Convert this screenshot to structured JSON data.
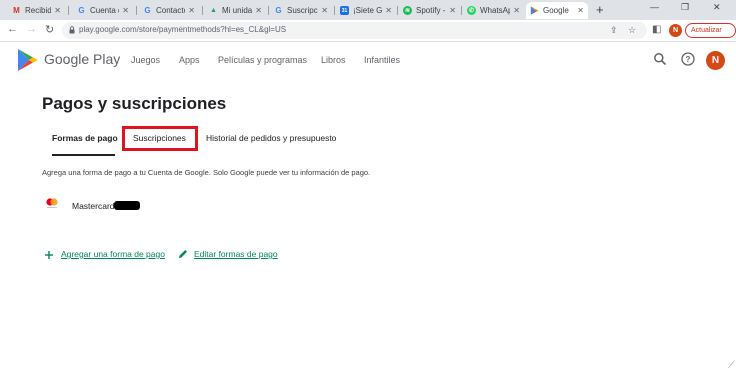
{
  "browser": {
    "tabs": [
      {
        "label": "Recibido",
        "favicon": "gmail-icon",
        "color": "#d93025",
        "glyph": "M"
      },
      {
        "label": "Cuenta de",
        "favicon": "google-icon",
        "color": "#4285f4",
        "glyph": "G"
      },
      {
        "label": "Contacto",
        "favicon": "google-icon",
        "color": "#4285f4",
        "glyph": "G"
      },
      {
        "label": "Mi unidad",
        "favicon": "drive-icon",
        "color": "#1fa463",
        "glyph": "▲"
      },
      {
        "label": "Suscripc",
        "favicon": "google-icon",
        "color": "#4285f4",
        "glyph": "G"
      },
      {
        "label": "¡Siete Gr",
        "favicon": "calendar-icon",
        "color": "#1a73e8",
        "glyph": "31"
      },
      {
        "label": "Spotify -",
        "favicon": "spotify-icon",
        "color": "#1db954",
        "glyph": "≋"
      },
      {
        "label": "WhatsApp",
        "favicon": "whatsapp-icon",
        "color": "#25d366",
        "glyph": "✆"
      },
      {
        "label": "Google",
        "favicon": "play-icon",
        "color": "#ffffff",
        "glyph": "▶"
      }
    ],
    "new_tab": "+",
    "url": "play.google.com/store/paymentmethods?hl=es_CL&gl=US",
    "update_button": "Actualizar",
    "profile_initial": "N"
  },
  "header": {
    "logo_text": "Google Play",
    "nav": [
      "Juegos",
      "Apps",
      "Películas y programas",
      "Libros",
      "Infantiles"
    ],
    "profile_initial": "N"
  },
  "main": {
    "title": "Pagos y suscripciones",
    "tabs": [
      "Formas de pago",
      "Suscripciones",
      "Historial de pedidos y presupuesto"
    ],
    "active_tab": "Formas de pago",
    "info_text": "Agrega una forma de pago a tu Cuenta de Google. Solo Google puede ver tu información de pago.",
    "payment_method": "Mastercard",
    "actions": {
      "add": "Agregar una forma de pago",
      "edit": "Editar formas de pago"
    }
  },
  "colors": {
    "accent": "#01875f",
    "highlight": "#e0141e",
    "avatar": "#d24a14"
  }
}
